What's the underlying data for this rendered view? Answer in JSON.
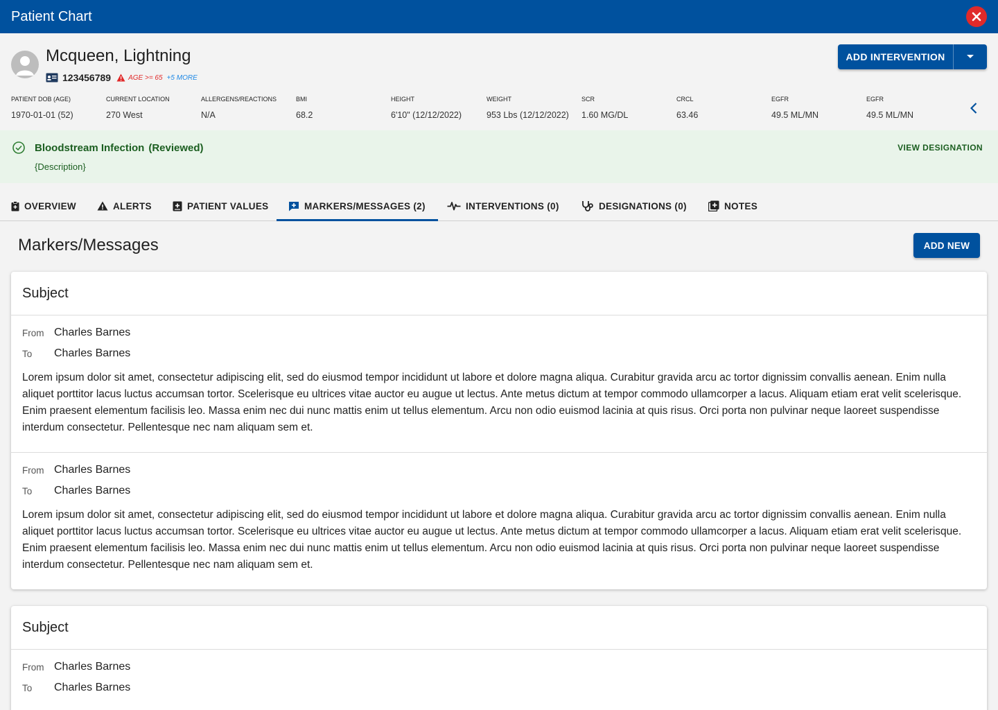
{
  "window": {
    "title": "Patient Chart"
  },
  "patient": {
    "name": "Mcqueen, Lightning",
    "mrn": "123456789",
    "alert": "AGE >= 65",
    "more": "+5 MORE"
  },
  "actions": {
    "add_intervention": "ADD INTERVENTION",
    "add_new": "ADD NEW"
  },
  "vitals": [
    {
      "label": "PATIENT DOB (AGE)",
      "value": "1970-01-01 (52)"
    },
    {
      "label": "CURRENT LOCATION",
      "value": "270 West"
    },
    {
      "label": "ALLERGENS/REACTIONS",
      "value": "N/A"
    },
    {
      "label": "BMI",
      "value": "68.2"
    },
    {
      "label": "HEIGHT",
      "value": "6'10\" (12/12/2022)"
    },
    {
      "label": "WEIGHT",
      "value": "953 Lbs (12/12/2022)"
    },
    {
      "label": "SCR",
      "value": "1.60 MG/DL"
    },
    {
      "label": "CRCL",
      "value": "63.46"
    },
    {
      "label": "EGFR",
      "value": "49.5 ML/MN"
    },
    {
      "label": "EGFR",
      "value": "49.5 ML/MN"
    }
  ],
  "designation": {
    "title": "Bloodstream Infection",
    "status": "(Reviewed)",
    "description": "{Description}",
    "action": "VIEW DESIGNATION"
  },
  "tabs": [
    {
      "label": "OVERVIEW",
      "icon": "clipboard-icon"
    },
    {
      "label": "ALERTS",
      "icon": "warning-icon"
    },
    {
      "label": "PATIENT VALUES",
      "icon": "medical-book-icon"
    },
    {
      "label": "MARKERS/MESSAGES (2)",
      "icon": "message-flag-icon",
      "active": true
    },
    {
      "label": "INTERVENTIONS (0)",
      "icon": "pulse-icon"
    },
    {
      "label": "DESIGNATIONS (0)",
      "icon": "stethoscope-icon"
    },
    {
      "label": "NOTES",
      "icon": "add-note-icon"
    }
  ],
  "section": {
    "title": "Markers/Messages"
  },
  "meta_labels": {
    "from": "From",
    "to": "To"
  },
  "cards": [
    {
      "subject": "Subject",
      "messages": [
        {
          "from": "Charles Barnes",
          "to": "Charles Barnes",
          "body": "Lorem ipsum dolor sit amet, consectetur adipiscing elit, sed do eiusmod tempor incididunt ut labore et dolore magna aliqua. Curabitur gravida arcu ac tortor dignissim convallis aenean. Enim nulla aliquet porttitor lacus luctus accumsan tortor. Scelerisque eu ultrices vitae auctor eu augue ut lectus. Ante metus dictum at tempor commodo ullamcorper a lacus. Aliquam etiam erat velit scelerisque. Enim praesent elementum facilisis leo. Massa enim nec dui nunc mattis enim ut tellus elementum. Arcu non odio euismod lacinia at quis risus. Orci porta non pulvinar neque laoreet suspendisse interdum consectetur. Pellentesque nec nam aliquam sem et."
        },
        {
          "from": "Charles Barnes",
          "to": "Charles Barnes",
          "body": "Lorem ipsum dolor sit amet, consectetur adipiscing elit, sed do eiusmod tempor incididunt ut labore et dolore magna aliqua. Curabitur gravida arcu ac tortor dignissim convallis aenean. Enim nulla aliquet porttitor lacus luctus accumsan tortor. Scelerisque eu ultrices vitae auctor eu augue ut lectus. Ante metus dictum at tempor commodo ullamcorper a lacus. Aliquam etiam erat velit scelerisque. Enim praesent elementum facilisis leo. Massa enim nec dui nunc mattis enim ut tellus elementum. Arcu non odio euismod lacinia at quis risus. Orci porta non pulvinar neque laoreet suspendisse interdum consectetur. Pellentesque nec nam aliquam sem et."
        }
      ]
    },
    {
      "subject": "Subject",
      "messages": [
        {
          "from": "Charles Barnes",
          "to": "Charles Barnes"
        }
      ]
    }
  ],
  "colors": {
    "primary": "#00519e",
    "danger": "#e02a2a",
    "success_bg": "#e9f4ea",
    "success_text": "#1b5e20"
  }
}
